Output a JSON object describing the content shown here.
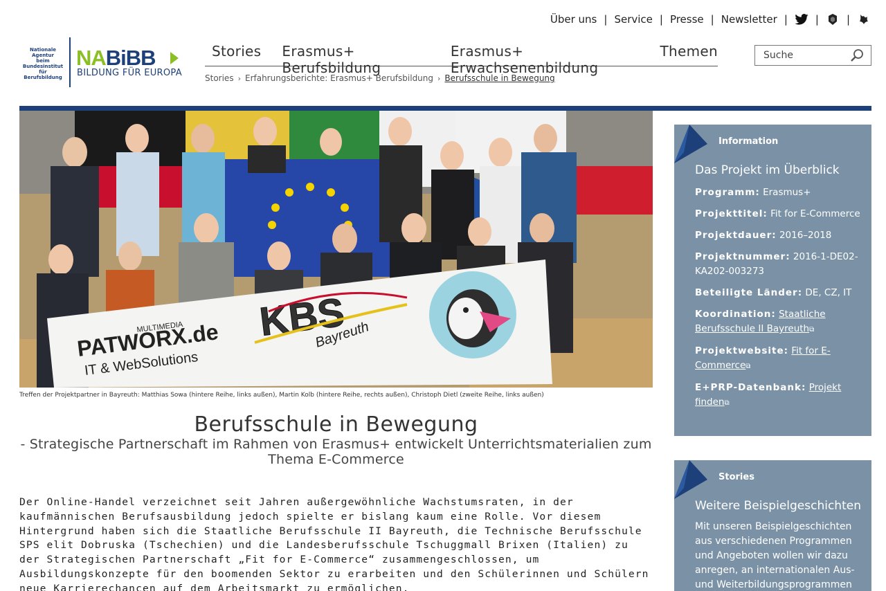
{
  "topnav": {
    "links": [
      "Über uns",
      "Service",
      "Presse",
      "Newsletter"
    ],
    "icons": [
      "twitter-icon",
      "podcast-icon",
      "soundcloud-icon"
    ]
  },
  "logo": {
    "agency_lines": [
      "Nationale Agentur",
      "beim Bundesinstitut",
      "für Berufsbildung"
    ],
    "brand_green": "NA",
    "brand_blue": "BiBB",
    "subtitle": "BILDUNG FÜR EUROPA"
  },
  "mainnav": [
    "Stories",
    "Erasmus+ Berufsbildung",
    "Erasmus+ Erwachsenenbildung",
    "Themen"
  ],
  "breadcrumb": {
    "items": [
      "Stories",
      "Erfahrungsberichte: Erasmus+ Berufsbildung"
    ],
    "current": "Berufsschule in Bewegung"
  },
  "search": {
    "placeholder": "Suche"
  },
  "hero": {
    "banner_left_top": "MULTIMEDIA",
    "banner_left_main": "PATWORX.de",
    "banner_left_sub": "IT & WebSolutions",
    "banner_mid_main": "KBS",
    "banner_mid_sub": "Bayreuth"
  },
  "caption": "Treffen der Projektpartner in Bayreuth: Matthias Sowa (hintere Reihe, links außen), Martin Kolb (hintere Reihe, rechts außen), Christoph Dietl (zweite Reihe, links außen)",
  "article": {
    "title": "Berufsschule in Bewegung",
    "subtitle": "- Strategische Partnerschaft im Rahmen von Erasmus+ entwickelt Unterrichtsmaterialien zum Thema E-Commerce",
    "lead": "Der Online-Handel verzeichnet seit Jahren außergewöhnliche Wachstumsraten, in der kaufmännischen Berufsausbildung jedoch spielte er bislang kaum eine Rolle. Vor diesem Hintergrund haben sich die Staatliche Berufsschule II Bayreuth, die Technische Berufsschule SPS elit Dobruska (Tschechien) und die Landesberufsschule Tschuggmall Brixen (Italien) zu der Strategischen Partnerschaft „Fit for E-Commerce“ zusammengeschlossen, um Ausbildungskonzepte für den boomenden Sektor zu erarbeiten und den Schülerinnen und Schülern neue Karrierechancen auf dem Arbeitsmarkt zu ermöglichen."
  },
  "info": {
    "tag": "Information",
    "title": "Das Projekt im Überblick",
    "programm_k": "Programm:",
    "programm_v": "Erasmus+",
    "titel_k": "Projekttitel:",
    "titel_v": "Fit for E-Commerce",
    "dauer_k": "Projektdauer:",
    "dauer_v": "2016–2018",
    "nummer_k": "Projektnummer:",
    "nummer_v": "2016-1-DE02-KA202-003273",
    "laender_k": "Beteiligte Länder:",
    "laender_v": "DE, CZ, IT",
    "koord_k": "Koordination:",
    "koord_v": "Staatliche Berufsschule II Bayreuth",
    "web_k": "Projektwebsite:",
    "web_v": "Fit for E-Commerce",
    "db_k": "E+PRP-Datenbank:",
    "db_v": "Projekt finden"
  },
  "stories": {
    "tag": "Stories",
    "title": "Weitere Beispielgeschichten",
    "text": "Mit unseren Beispielgeschichten aus verschiedenen Programmen und Angeboten wollen wir dazu anregen, an internationalen Aus- und Weiterbildungsprogrammen"
  },
  "colors": {
    "brand_blue": "#1d3f7a",
    "brand_green": "#8cbf26",
    "sidebox": "#7a91a6"
  }
}
